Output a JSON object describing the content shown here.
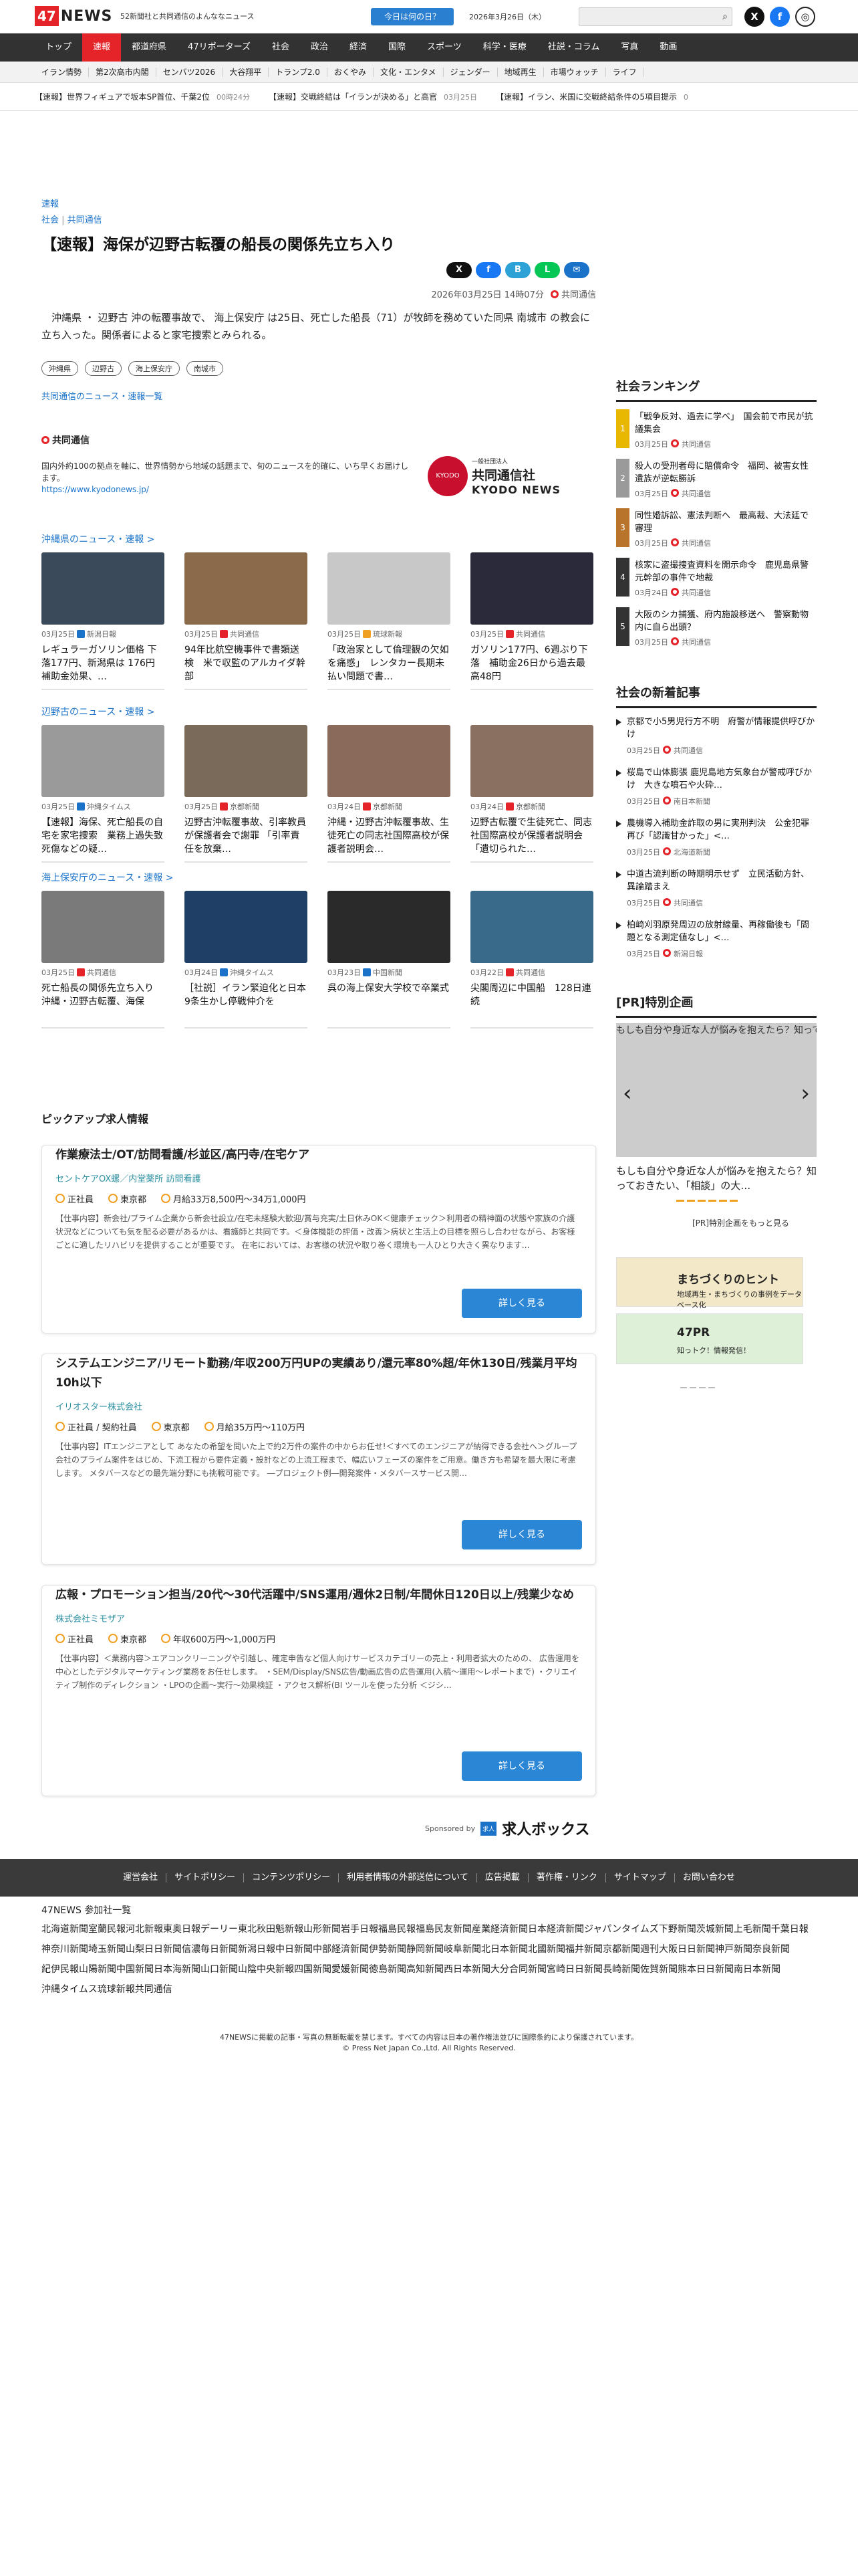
{
  "header": {
    "logo_num": "47",
    "logo_word": "NEWS",
    "tagline": "52新聞社と共同通信のよんななニュース",
    "today_button": "今日は何の日？",
    "date": "2026年3月26日（木）",
    "search_placeholder": ""
  },
  "nav": [
    "トップ",
    "速報",
    "都道府県",
    "47リポーターズ",
    "社会",
    "政治",
    "経済",
    "国際",
    "スポーツ",
    "科学・医療",
    "社説・コラム",
    "写真",
    "動画"
  ],
  "subnav": [
    "イラン情勢",
    "第2次高市内閣",
    "センバツ2026",
    "大谷翔平",
    "トランプ2.0",
    "おくやみ",
    "文化・エンタメ",
    "ジェンダー",
    "地域再生",
    "市場ウォッチ",
    "ライフ"
  ],
  "ticker": [
    {
      "text": "【速報】世界フィギュアで坂本SP首位、千葉2位",
      "time": "00時24分"
    },
    {
      "text": "【速報】交戦終結は「イランが決める」と高官",
      "time": "03月25日"
    },
    {
      "text": "【速報】イラン、米国に交戦終結条件の5項目提示",
      "time": "0"
    }
  ],
  "article": {
    "breaking": "速報",
    "category": "社会",
    "source_cat": "共同通信",
    "title": "【速報】海保が辺野古転覆の船長の関係先立ち入り",
    "datetime": "2026年03月25日 14時07分",
    "source": "共同通信",
    "lead": "沖縄県 ・ 辺野古 沖の転覆事故で、 海上保安庁 は25日、死亡した船長（71）が牧師を務めていた同県 南城市 の教会に立ち入った。関係者によると家宅捜索とみられる。",
    "tags": [
      "沖縄県",
      "辺野古",
      "海上保安庁",
      "南城市"
    ],
    "more_link": "共同通信のニュース・速報一覧"
  },
  "share": [
    "X",
    "f",
    "B",
    "L",
    "✉"
  ],
  "kyodo": {
    "name": "共同通信",
    "desc": "国内外約100の拠点を軸に、世界情勢から地域の話題まで、旬のニュースを的確に、いち早くお届けします。",
    "url": "https://www.kyodonews.jp/",
    "logo_small": "一般社団法人",
    "logo_jp": "共同通信社",
    "logo_en": "KYODO NEWS",
    "logo_badge": "KYODO"
  },
  "sections": [
    {
      "title": "沖縄県のニュース・速報 >",
      "cards": [
        {
          "date": "03月25日",
          "src": "新潟日報",
          "title": "レギュラーガソリン価格 下落177円、新潟県は 176円　補助金効果、…",
          "color": "#3a4a5a",
          "src_color": "#1a73c9"
        },
        {
          "date": "03月25日",
          "src": "共同通信",
          "title": "94年比航空機事件で書類送検　米で収監のアルカイダ幹部",
          "color": "#8a6a4a",
          "src_color": "#e5242a"
        },
        {
          "date": "03月25日",
          "src": "琉球新報",
          "title": "「政治家として倫理観の欠如を痛感」　レンタカー長期未払い問題で書…",
          "color": "#c8c8c8",
          "src_color": "#f0a020"
        },
        {
          "date": "03月25日",
          "src": "共同通信",
          "title": "ガソリン177円、6週ぶり下落　補助金26日から過去最高48円",
          "color": "#2a2a3a",
          "src_color": "#e5242a"
        }
      ]
    },
    {
      "title": "辺野古のニュース・速報 >",
      "cards": [
        {
          "date": "03月25日",
          "src": "沖縄タイムス",
          "title": "【速報】海保、死亡船長の自宅を家宅捜索　業務上過失致死傷などの疑…",
          "color": "#9a9a9a",
          "src_color": "#1a73c9"
        },
        {
          "date": "03月25日",
          "src": "京都新聞",
          "title": "辺野古沖転覆事故、引率教員が保護者会で謝罪 「引率責任を放棄…",
          "color": "#7a6a5a",
          "src_color": "#e5242a"
        },
        {
          "date": "03月24日",
          "src": "京都新聞",
          "title": "沖縄・辺野古沖転覆事故、生徒死亡の同志社国際高校が保護者説明会…",
          "color": "#8a6a5a",
          "src_color": "#e5242a"
        },
        {
          "date": "03月24日",
          "src": "京都新聞",
          "title": "辺野古転覆で生徒死亡、同志社国際高校が保護者説明会　「遺切られた…",
          "color": "#8a7060",
          "src_color": "#e5242a"
        }
      ]
    },
    {
      "title": "海上保安庁のニュース・速報 >",
      "cards": [
        {
          "date": "03月25日",
          "src": "共同通信",
          "title": "死亡船長の関係先立ち入り　沖縄・辺野古転覆、海保",
          "color": "#7a7a7a",
          "src_color": "#e5242a"
        },
        {
          "date": "03月24日",
          "src": "沖縄タイムス",
          "title": "［社説］イラン緊迫化と日本　9条生かし停戦仲介を",
          "color": "#1f3f66",
          "src_color": "#1a73c9"
        },
        {
          "date": "03月23日",
          "src": "中国新聞",
          "title": "呉の海上保安大学校で卒業式",
          "color": "#2a2a2a",
          "src_color": "#1a73c9"
        },
        {
          "date": "03月22日",
          "src": "共同通信",
          "title": "尖閣周辺に中国船　128日連続",
          "color": "#3a6a8a",
          "src_color": "#e5242a"
        }
      ]
    }
  ],
  "pickup": "ピックアップ求人情報",
  "jobs": [
    {
      "title": "作業療法士/OT/訪問看護/杉並区/高円寺/在宅ケア",
      "company": "セントケアOX螺／内堂薬所 訪問看護",
      "type": "正社員",
      "loc": "東京都",
      "salary": "月給33万8,500円〜34万1,000円",
      "desc": "【仕事内容】新会社/プライム企業から新会社設立/在宅未経験大歓迎/賞与充実/土日休みOK＜健康チェック＞利用者の精神面の状態や家族の介護状況などについても気を配る必要があるかは、看護師と共同です。＜身体機能の評価・改善＞病状と生活上の目標を照らし合わせながら、お客様ごとに適したリハビリを提供することが重要です。 在宅においては、お客様の状況や取り巻く環境も一人ひとり大きく異なります…",
      "button": "詳しく見る"
    },
    {
      "title": "システムエンジニア/リモート勤務/年収200万円UPの実績あり/還元率80%超/年休130日/残業月平均10h以下",
      "company": "イリオスター株式会社",
      "type": "正社員 / 契約社員",
      "loc": "東京都",
      "salary": "月給35万円〜110万円",
      "desc": "【仕事内容】ITエンジニアとして あなたの希望を聞いた上で約2万件の案件の中からお任せ!＜すべてのエンジニアが納得できる会社へ＞グループ会社のプライム案件をはじめ、下流工程から要件定義・設計などの上流工程まで、幅広いフェーズの案件をご用意。働き方も希望を最大限に考慮します。 メタバースなどの最先端分野にも挑戦可能です。 ―プロジェクト例―開発案件・メタバースサービス開…",
      "button": "詳しく見る"
    },
    {
      "title": "広報・プロモーション担当/20代〜30代活躍中/SNS運用/週休2日制/年間休日120日以上/残業少なめ",
      "company": "株式会社ミモザア",
      "type": "正社員",
      "loc": "東京都",
      "salary": "年収600万円〜1,000万円",
      "desc": "【仕事内容】＜業務内容＞エアコンクリーニングや引越し、確定申告など個人向けサービスカテゴリーの売上・利用者拡大のための、 広告運用を中心としたデジタルマーケティング業務をお任せします。 ・SEM/Display/SNS広告/動画広告の広告運用(入稿〜運用〜レポートまで) ・クリエイティブ制作のディレクション ・LPOの企画〜実行〜効果検証 ・アクセス解析(BI ツールを使った分析 ＜ジシ…",
      "button": "詳しく見る"
    }
  ],
  "sponsor": {
    "label": "Sponsored by",
    "badge": "求人",
    "brand": "求人ボックス"
  },
  "ranking": {
    "title": "社会ランキング",
    "items": [
      {
        "num": "1",
        "title": "「戦争反対、過去に学べ」　国会前で市民が抗議集会",
        "date": "03月25日",
        "src": "共同通信",
        "color": "#e8b800"
      },
      {
        "num": "2",
        "title": "殺人の受刑者母に賠償命令　福岡、被害女性遺族が逆転勝訴",
        "date": "03月25日",
        "src": "共同通信",
        "color": "#9a9a9a"
      },
      {
        "num": "3",
        "title": "同性婚訴訟、憲法判断へ　最高裁、大法廷で審理",
        "date": "03月25日",
        "src": "共同通信",
        "color": "#b8742a"
      },
      {
        "num": "4",
        "title": "核家に盗撮捜査資料を開示命令　鹿児島県警元幹部の事件で地裁",
        "date": "03月24日",
        "src": "共同通信",
        "color": "#333333"
      },
      {
        "num": "5",
        "title": "大阪のシカ捕獲、府内施設移送へ　警察動物内に自ら出頭？",
        "date": "03月25日",
        "src": "共同通信",
        "color": "#333333"
      }
    ]
  },
  "new_articles": {
    "title": "社会の新着記事",
    "items": [
      {
        "title": "京都で小5男児行方不明　府警が情報提供呼びかけ",
        "date": "03月25日",
        "src": "共同通信"
      },
      {
        "title": "桜島で山体膨張 鹿児島地方気象台が警戒呼びかけ　大きな噴石や火砕…",
        "date": "03月25日",
        "src": "南日本新聞"
      },
      {
        "title": "農機導入補助金詐取の男に実刑判決　公金犯罪再び「認識甘かった」<…",
        "date": "03月25日",
        "src": "北海道新聞"
      },
      {
        "title": "中道古流判断の時期明示せず　立民活動方針、異論踏まえ",
        "date": "03月25日",
        "src": "共同通信"
      },
      {
        "title": "柏崎刈羽原発周辺の放射線量、再稼働後も「問題となる測定値なし」<…",
        "date": "03月25日",
        "src": "新潟日報"
      }
    ]
  },
  "pr": {
    "title": "[PR]特別企画",
    "caption": "もしも自分や身近な人が悩みを抱えたら？知っておきたい、「相談」の大切さ",
    "headline": "もしも自分や身近な人が悩みを抱えたら？知っておきたい、「相談」の大…",
    "more": "[PR]特別企画をもっと見る",
    "banner1_title": "まちづくりのヒント",
    "banner1_sub": "地域再生・まちづくりの事例をデータベース化",
    "banner2_title": "47PR",
    "banner2_sub": "知っトク！情報発信！"
  },
  "footer": {
    "links": [
      "運営会社",
      "サイトポリシー",
      "コンテンツポリシー",
      "利用者情報の外部送信について",
      "広告掲載",
      "著作権・リンク",
      "サイトマップ",
      "お問い合わせ"
    ],
    "members_title": "47NEWS 参加社一覧",
    "members": [
      "北海道新聞",
      "室蘭民報",
      "河北新報",
      "東奥日報",
      "デーリー東北",
      "秋田魁新報",
      "山形新聞",
      "岩手日報",
      "福島民報",
      "福島民友新聞",
      "産業経済新聞",
      "日本経済新聞",
      "ジャパンタイムズ",
      "下野新聞",
      "茨城新聞",
      "上毛新聞",
      "千葉日報",
      "神奈川新聞",
      "埼玉新聞",
      "山梨日日新聞",
      "信濃毎日新聞",
      "新潟日報",
      "中日新聞",
      "中部経済新聞",
      "伊勢新聞",
      "静岡新聞",
      "岐阜新聞",
      "北日本新聞",
      "北國新聞",
      "福井新聞",
      "京都新聞",
      "週刊大阪日日新聞",
      "神戸新聞",
      "奈良新聞",
      "紀伊民報",
      "山陽新聞",
      "中国新聞",
      "日本海新聞",
      "山口新聞",
      "山陰中央新報",
      "四国新聞",
      "愛媛新聞",
      "徳島新聞",
      "高知新聞",
      "西日本新聞",
      "大分合同新聞",
      "宮崎日日新聞",
      "長崎新聞",
      "佐賀新聞",
      "熊本日日新聞",
      "南日本新聞",
      "沖縄タイムス",
      "琉球新報",
      "共同通信"
    ],
    "note": "47NEWSに掲載の記事・写真の無断転載を禁じます。すべての内容は日本の著作権法並びに国際条約により保護されています。",
    "copyright": "© Press Net Japan Co.,Ltd. All Rights Reserved."
  },
  "colors": {
    "brand_red": "#e5242a",
    "link_blue": "#1a73c9",
    "nav_dark": "#323232"
  }
}
